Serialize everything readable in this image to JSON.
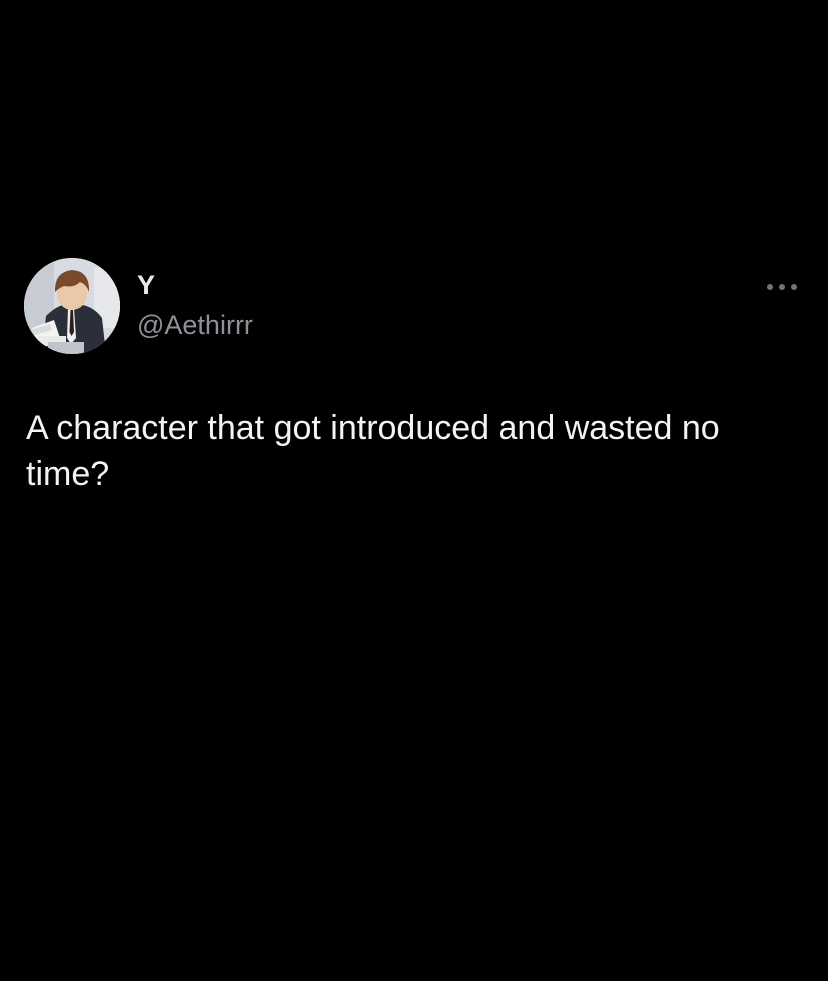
{
  "tweet": {
    "author": {
      "display_name": "Y",
      "handle": "@Aethirrr",
      "avatar_icon": "profile-photo-anime-character"
    },
    "more_icon": "more-horizontal-icon",
    "text": "A character that got introduced and wasted no time?"
  },
  "colors": {
    "background": "#000000",
    "primary_text": "#e7e9ea",
    "secondary_text": "#8e9297"
  }
}
